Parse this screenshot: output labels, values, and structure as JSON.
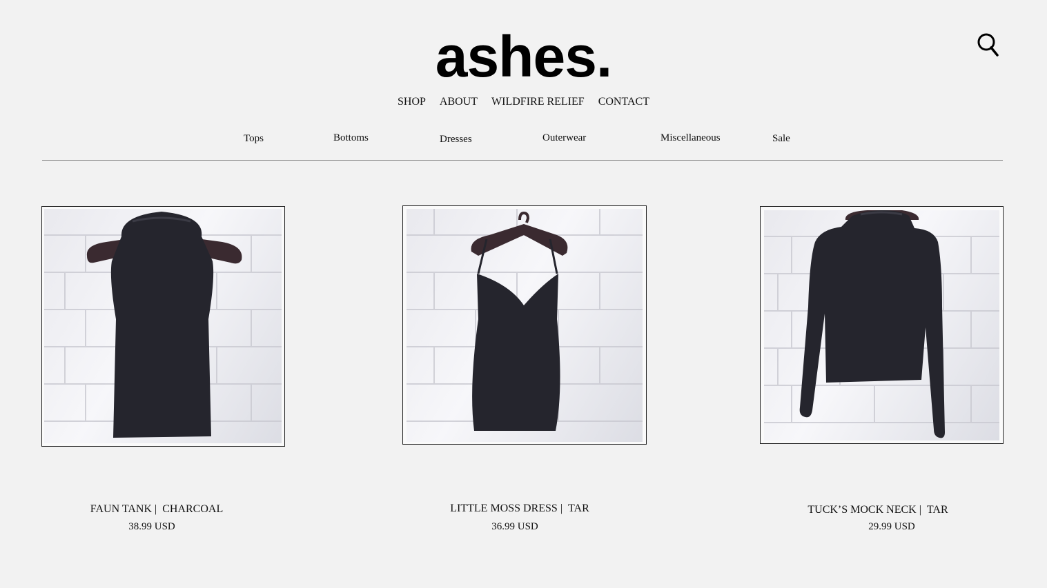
{
  "brand": {
    "logo_text": "ashes."
  },
  "header": {
    "search_icon": "search-icon"
  },
  "nav": {
    "main": [
      "SHOP",
      "ABOUT",
      "WILDFIRE RELIEF",
      "CONTACT"
    ],
    "categories": [
      "Tops",
      "Bottoms",
      "Dresses",
      "Outerwear",
      "Miscellaneous",
      "Sale"
    ]
  },
  "products": [
    {
      "name": "FAUN TANK |",
      "color": "CHARCOAL",
      "price": "38.99 USD",
      "image_subject": "sleeveless mock neck tank on hanger"
    },
    {
      "name": "LITTLE MOSS DRESS |",
      "color": "TAR",
      "price": "36.99 USD",
      "image_subject": "spaghetti strap slip dress on hanger"
    },
    {
      "name": "TUCK’S MOCK NECK |",
      "color": "TAR",
      "price": "29.99 USD",
      "image_subject": "long sleeve mock neck top on hanger"
    }
  ],
  "colors": {
    "background": "#f2f2f2",
    "text": "#111111",
    "garment": "#25252d",
    "divider": "#8a8a8a"
  }
}
